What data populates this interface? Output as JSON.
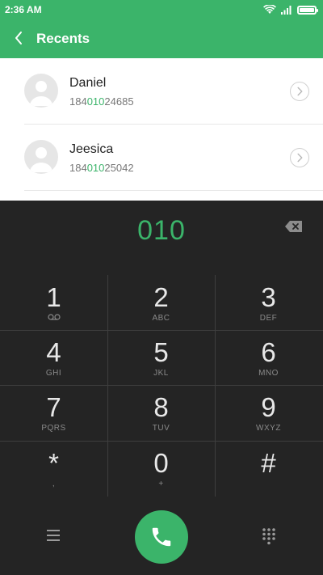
{
  "status_bar": {
    "time": "2:36 AM",
    "icons": [
      "wifi-icon",
      "signal-icon",
      "battery-icon"
    ],
    "battery_level": 1.0
  },
  "app_bar": {
    "title": "Recents",
    "back_icon": "chevron-left-icon"
  },
  "contacts": [
    {
      "name": "Daniel",
      "number_prefix": "184",
      "number_match": "010",
      "number_suffix": "24685"
    },
    {
      "name": "Jeesica",
      "number_prefix": "184",
      "number_match": "010",
      "number_suffix": "25042"
    }
  ],
  "dialer": {
    "entered_digits": "010",
    "keys": [
      {
        "digit": "1",
        "letters": ""
      },
      {
        "digit": "2",
        "letters": "ABC"
      },
      {
        "digit": "3",
        "letters": "DEF"
      },
      {
        "digit": "4",
        "letters": "GHI"
      },
      {
        "digit": "5",
        "letters": "JKL"
      },
      {
        "digit": "6",
        "letters": "MNO"
      },
      {
        "digit": "7",
        "letters": "PQRS"
      },
      {
        "digit": "8",
        "letters": "TUV"
      },
      {
        "digit": "9",
        "letters": "WXYZ"
      },
      {
        "digit": "*",
        "letters": ","
      },
      {
        "digit": "0",
        "letters": "+"
      },
      {
        "digit": "#",
        "letters": ""
      }
    ]
  },
  "colors": {
    "accent": "#3bb46a",
    "dialpad_bg": "#242424",
    "list_bg": "#ffffff"
  }
}
